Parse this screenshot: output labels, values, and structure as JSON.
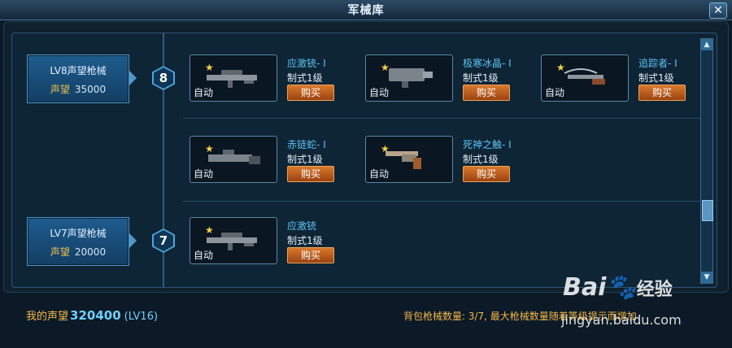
{
  "window": {
    "title": "军械库",
    "close_label": "✕"
  },
  "levels": [
    {
      "title": "LV8声望枪械",
      "rep_label": "声望",
      "rep_value": "35000",
      "badge": "8"
    },
    {
      "title": "LV7声望枪械",
      "rep_label": "声望",
      "rep_value": "20000",
      "badge": "7"
    }
  ],
  "items": [
    {
      "name": "应激铳- I",
      "type": "制式1级",
      "mode": "自动",
      "buy": "购买",
      "icon": "rifle-icon"
    },
    {
      "name": "极寒冰晶- I",
      "type": "制式1级",
      "mode": "自动",
      "buy": "购买",
      "icon": "cannon-icon"
    },
    {
      "name": "追踪者- I",
      "type": "制式1级",
      "mode": "自动",
      "buy": "购买",
      "icon": "crossbow-icon"
    },
    {
      "name": "赤链蛇- I",
      "type": "制式1级",
      "mode": "自动",
      "buy": "购买",
      "icon": "launcher-icon"
    },
    {
      "name": "死神之触- I",
      "type": "制式1级",
      "mode": "自动",
      "buy": "购买",
      "icon": "revolver-icon"
    },
    {
      "name": "应激铳",
      "type": "制式1级",
      "mode": "自动",
      "buy": "购买",
      "icon": "rifle-icon"
    }
  ],
  "footer": {
    "rep_label": "我的声望",
    "rep_value": "320400",
    "rep_level": "(LV16)",
    "bag_info": "背包枪械数量: 3/7, 最大枪械数量随着等级提示而增加"
  },
  "watermark": {
    "brand": "Bai",
    "brand2": "经验",
    "url": "jingyan.baidu.com"
  },
  "colors": {
    "accent": "#5fc3f3",
    "gold": "#f2b84a",
    "buy": "#d9782c"
  }
}
